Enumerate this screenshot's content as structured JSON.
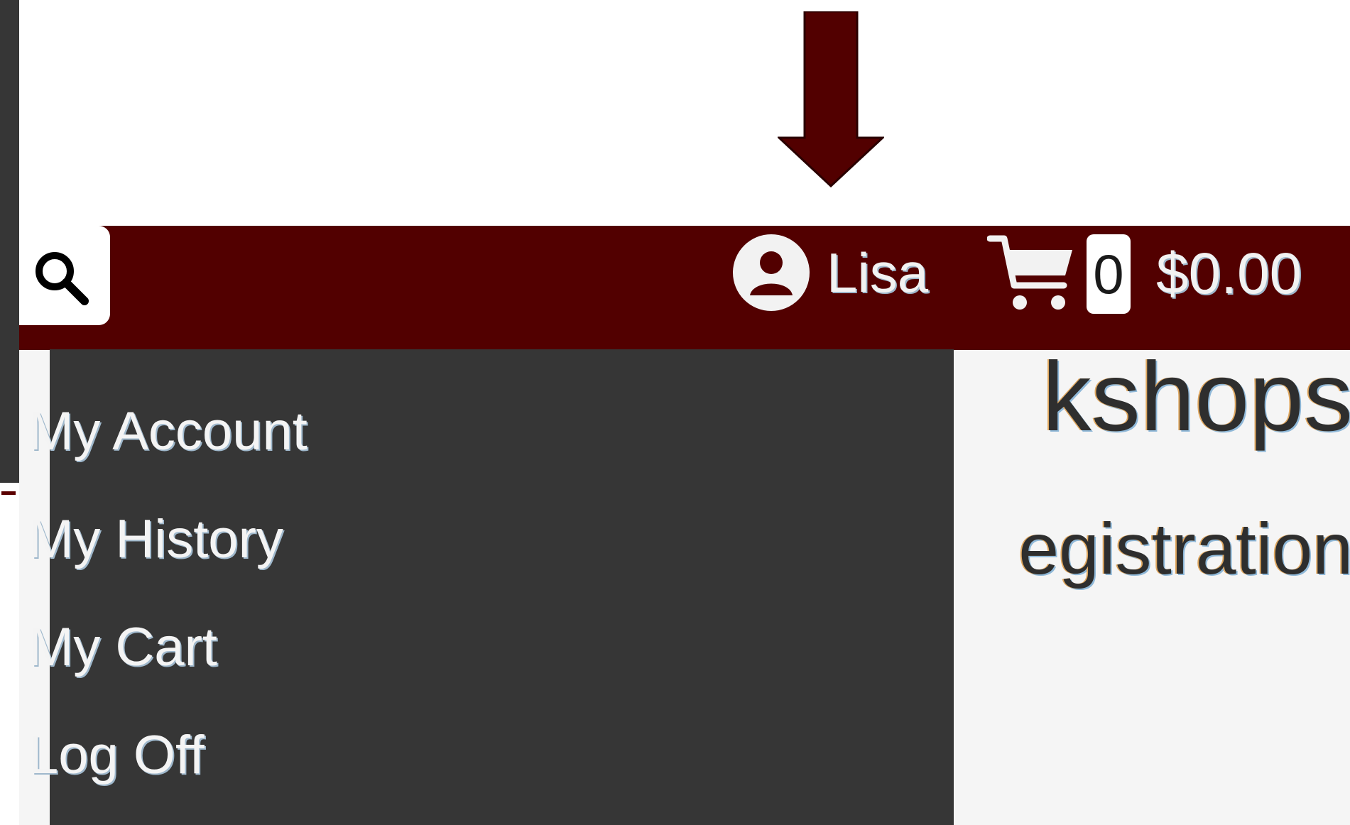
{
  "header": {
    "user_name": "Lisa",
    "cart_count": "0",
    "cart_total": "$0.00"
  },
  "page": {
    "heading_fragment": "kshops",
    "subheading_fragment": "egistration"
  },
  "user_menu": {
    "items": [
      {
        "label": "My Account"
      },
      {
        "label": "My History"
      },
      {
        "label": "My Cart"
      },
      {
        "label": "Log Off"
      }
    ]
  },
  "icons": {
    "search": "search-icon",
    "user": "user-circle-icon",
    "cart": "shopping-cart-icon",
    "annotation": "arrow-down-icon"
  },
  "colors": {
    "header_bg": "#520000",
    "dropdown_bg": "#363636",
    "page_bg": "#f5f5f5",
    "arrow": "#520000"
  }
}
